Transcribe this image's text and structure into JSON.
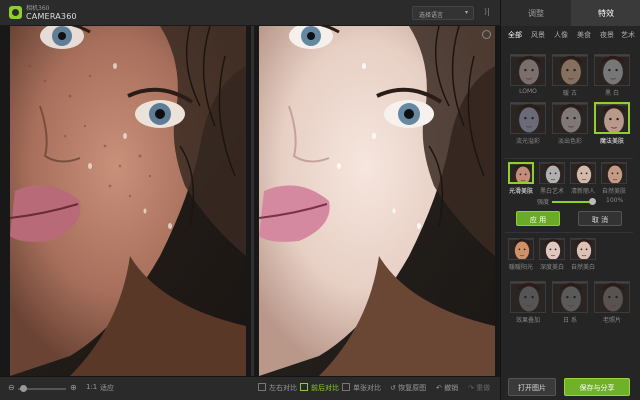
{
  "app": {
    "brand_cn": "相机360",
    "brand": "CAMERA360",
    "language_select": "选择语言",
    "icons": [
      "camera360-logo",
      "chevron-down-icon",
      "collapse-icon",
      "compare-icon"
    ]
  },
  "panel": {
    "tabs": [
      {
        "label": "调整",
        "active": false
      },
      {
        "label": "特效",
        "active": true
      }
    ],
    "categories": [
      {
        "label": "全部",
        "active": true
      },
      {
        "label": "风景",
        "active": false
      },
      {
        "label": "人像",
        "active": false
      },
      {
        "label": "美食",
        "active": false
      },
      {
        "label": "夜景",
        "active": false
      },
      {
        "label": "艺术",
        "active": false
      }
    ],
    "effects_top": [
      {
        "label": "LOMO",
        "tint": "#7a6f6a"
      },
      {
        "label": "暖 古",
        "tint": "#857060"
      },
      {
        "label": "黑 白",
        "tint": "#777777"
      },
      {
        "label": "流光溢彩",
        "tint": "#6a6a78"
      },
      {
        "label": "淡出色彩",
        "tint": "#807876"
      },
      {
        "label": "魔法美肤",
        "tint": "#b89a8a",
        "selected": true
      }
    ],
    "skin_effects": [
      {
        "label": "光滑美肤",
        "tint": "#c08e7a",
        "selected": true
      },
      {
        "label": "黑白艺术",
        "tint": "#b0b0b0",
        "selected": false
      },
      {
        "label": "清新丽人",
        "tint": "#d4b8aa",
        "selected": false
      },
      {
        "label": "自然美肤",
        "tint": "#c49a86",
        "selected": false
      }
    ],
    "strength_label": "强度",
    "strength_percent": "100%",
    "strength_value": 1.0,
    "apply_label": "应 用",
    "cancel_label": "取 消",
    "effects_mid": [
      {
        "label": "暖暖阳光",
        "tint": "#d09068"
      },
      {
        "label": "深度美白",
        "tint": "#e0c8c0"
      },
      {
        "label": "自然美白",
        "tint": "#dcc2b4"
      }
    ],
    "effects_bottom": [
      {
        "label": "效果叠加",
        "tint": "#555555"
      },
      {
        "label": "日 系",
        "tint": "#5a5a5a"
      },
      {
        "label": "老照片",
        "tint": "#585250"
      }
    ],
    "open_label": "打开图片",
    "save_label": "保存与分享"
  },
  "bottom": {
    "zoom_ratio": "1:1",
    "zoom_fit": "适应",
    "views": [
      {
        "label": "左右对比",
        "active": false
      },
      {
        "label": "前后对比",
        "active": true
      },
      {
        "label": "单张对比",
        "active": false
      }
    ],
    "restore_label": "恢复原图",
    "undo_label": "撤销",
    "redo_label": "重做"
  },
  "colors": {
    "accent": "#8ed02c",
    "panel_bg": "#252525",
    "photo_bg": "#181818"
  }
}
